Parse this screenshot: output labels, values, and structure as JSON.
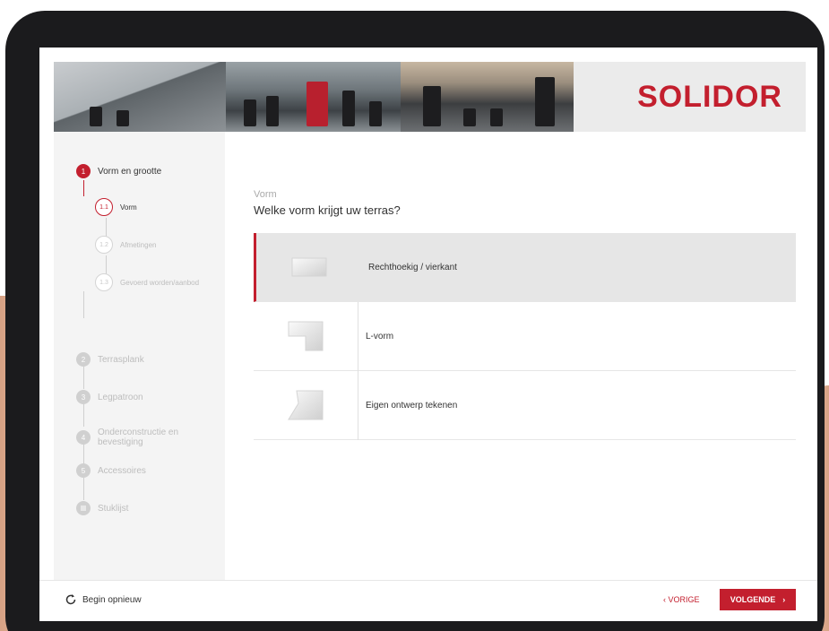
{
  "brand": {
    "logo_text": "SOLIDOR",
    "accent_color": "#c31f2e"
  },
  "sidebar": {
    "steps": [
      {
        "num": "1",
        "label": "Vorm en grootte",
        "active": true
      },
      {
        "num": "2",
        "label": "Terrasplank"
      },
      {
        "num": "3",
        "label": "Legpatroon"
      },
      {
        "num": "4",
        "label": "Onderconstructie en bevestiging"
      },
      {
        "num": "5",
        "label": "Accessoires"
      },
      {
        "num": "",
        "label": "Stuklijst",
        "icon": "list-icon"
      }
    ],
    "substeps": [
      {
        "num": "1.1",
        "label": "Vorm",
        "active": true
      },
      {
        "num": "1.2",
        "label": "Afmetingen"
      },
      {
        "num": "1.3",
        "label": "Gevoerd worden/aanbod"
      }
    ]
  },
  "main": {
    "label": "Vorm",
    "question": "Welke vorm krijgt uw terras?",
    "options": [
      {
        "label": "Rechthoekig / vierkant",
        "icon": "rectangle-shape-icon",
        "selected": true
      },
      {
        "label": "L-vorm",
        "icon": "l-shape-icon"
      },
      {
        "label": "Eigen ontwerp tekenen",
        "icon": "custom-shape-icon"
      }
    ]
  },
  "footer": {
    "restart_label": "Begin opnieuw",
    "restart_icon": "refresh-icon",
    "prev_label": "VORIGE",
    "next_label": "VOLGENDE"
  }
}
